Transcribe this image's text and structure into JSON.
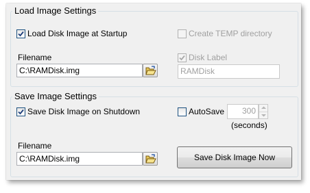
{
  "load_section": {
    "title": "Load Image Settings",
    "load_at_startup_label": "Load Disk Image at Startup",
    "load_at_startup_checked": true,
    "create_temp_label": "Create TEMP directory",
    "create_temp_checked": false,
    "filename_label": "Filename",
    "filename_value": "C:\\RAMDisk.img",
    "disk_label_label": "Disk Label",
    "disk_label_checked": true,
    "disk_label_value": "RAMDisk"
  },
  "save_section": {
    "title": "Save Image Settings",
    "save_on_shutdown_label": "Save Disk Image on Shutdown",
    "save_on_shutdown_checked": true,
    "autosave_label": "AutoSave",
    "autosave_checked": false,
    "autosave_value": "300",
    "seconds_label": "(seconds)",
    "filename_label": "Filename",
    "filename_value": "C:\\RAMDisk.img",
    "save_now_button": "Save Disk Image Now"
  },
  "icons": {
    "folder": "open-folder-icon",
    "check": "checkmark-icon",
    "spin_up": "spin-up-icon",
    "spin_down": "spin-down-icon"
  }
}
